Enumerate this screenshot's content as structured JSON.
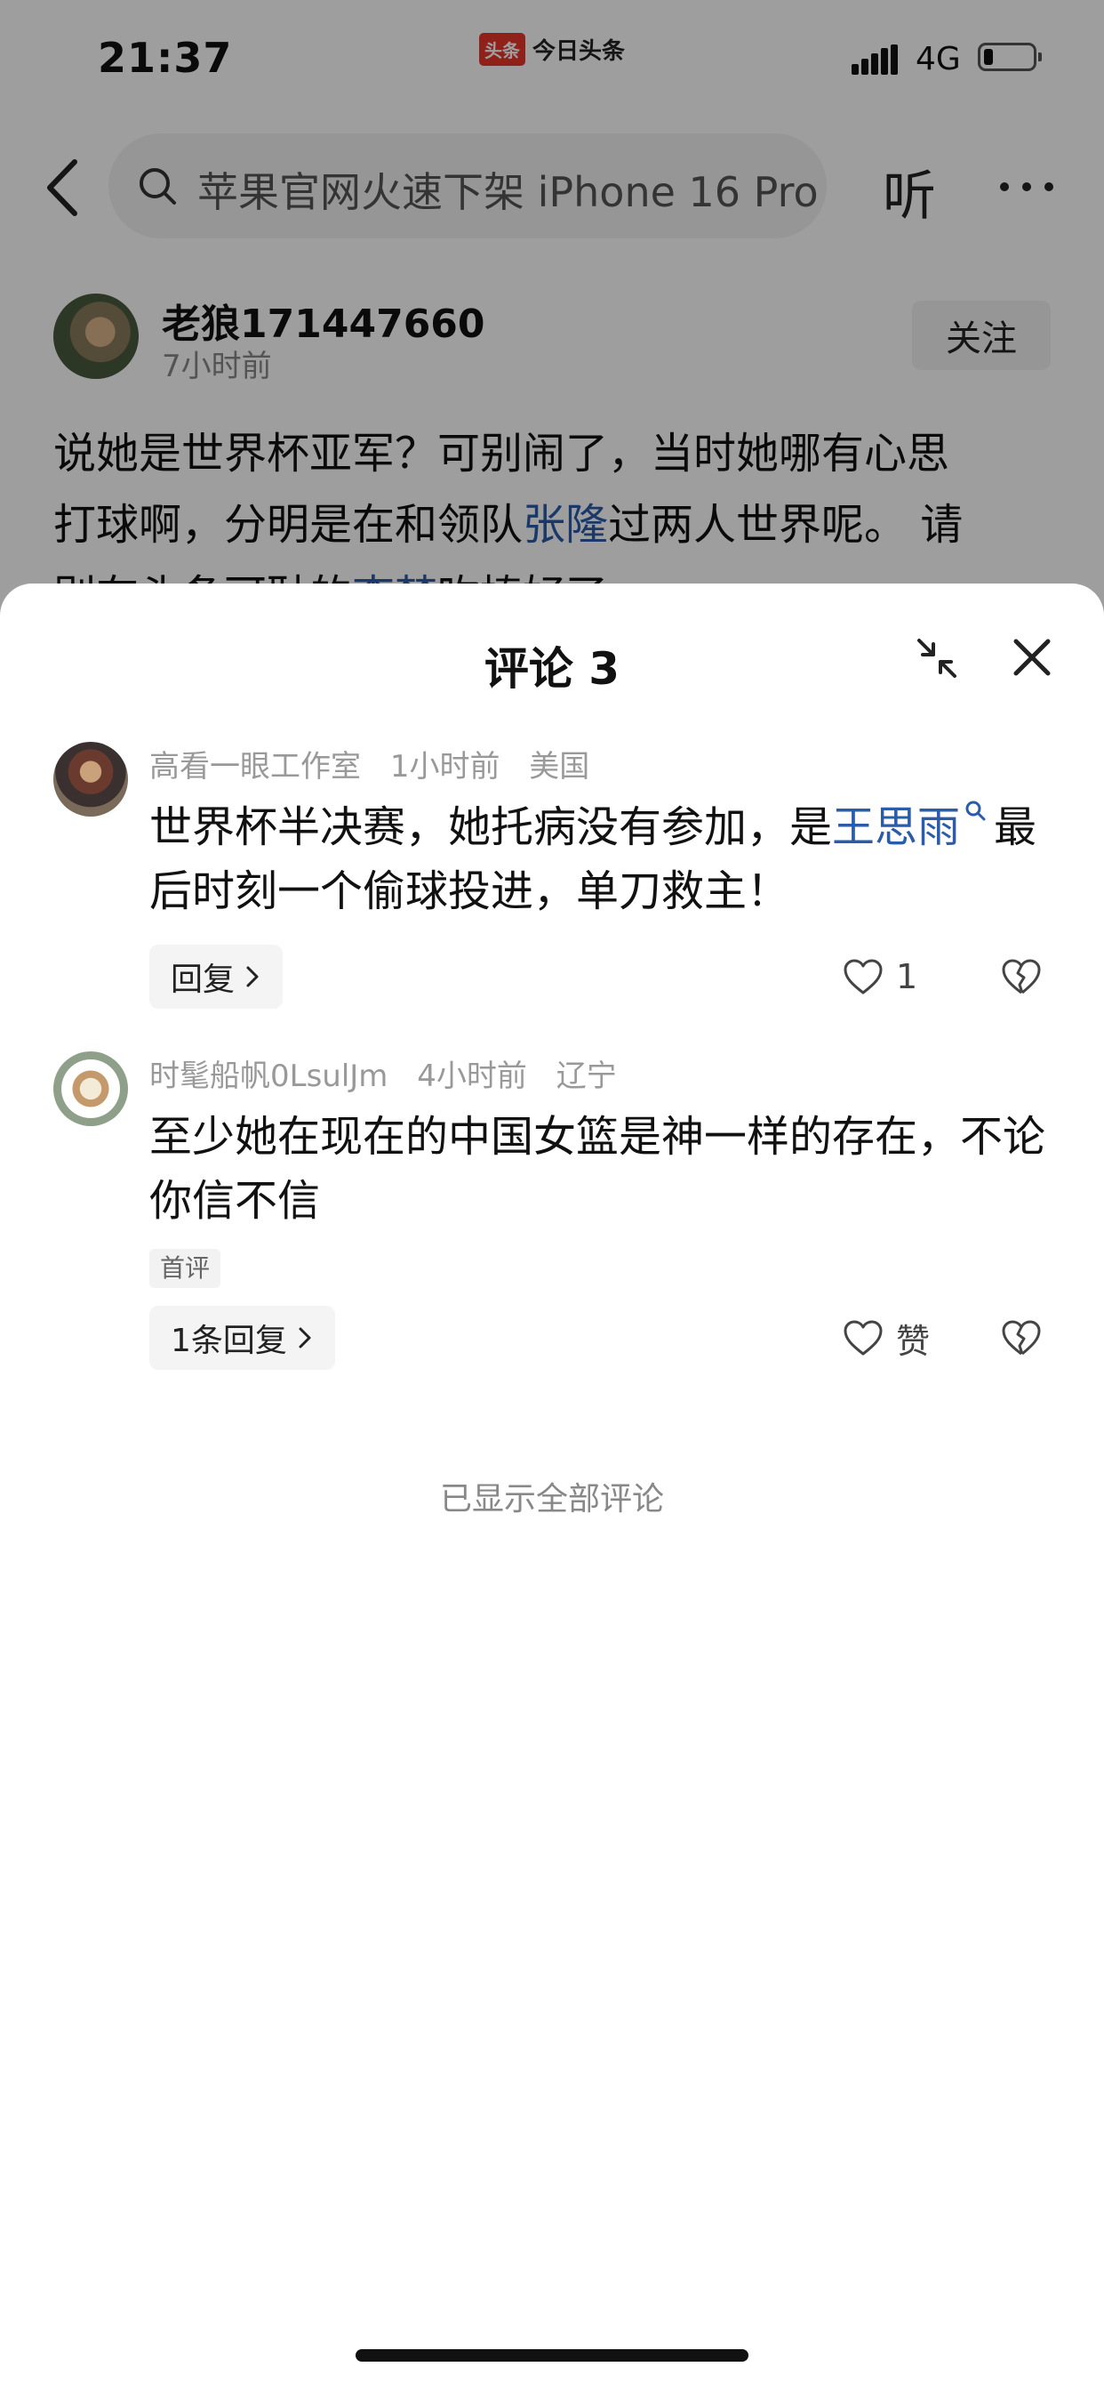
{
  "status_bar": {
    "time": "21:37",
    "app_badge_logo": "头条",
    "app_badge_name": "今日头条",
    "network": "4G",
    "battery_level": 0.2,
    "icons": [
      "signal-icon",
      "battery-icon"
    ]
  },
  "nav": {
    "search_text": "苹果官网火速下架 iPhone 16 Pro",
    "listen_label": "听",
    "icons": [
      "back-arrow-icon",
      "search-icon",
      "more-dots-icon"
    ]
  },
  "author": {
    "name": "老狼171447660",
    "time": "7小时前",
    "follow_label": "关注"
  },
  "article": {
    "line1": "说她是世界杯亚军？可别闹了，当时她哪有心思",
    "line2_pre": "打球啊，分明是在和领队",
    "line2_link": "张隆",
    "line2_post": "过两人世界呢。 请",
    "line3_pre": "别在头条可耻的",
    "line3_link": "李梦",
    "line3_post": "吹捧好了"
  },
  "sheet": {
    "title": "评论 3",
    "icons": [
      "collapse-icon",
      "close-icon"
    ],
    "all_shown": "已显示全部评论"
  },
  "comments": [
    {
      "user": "高看一眼工作室",
      "time": "1小时前",
      "location": "美国",
      "text_pre": "世界杯半决赛，她托病没有参加，是",
      "text_link": "王思雨",
      "text_post": "最后时刻一个偷球投进，单刀救主！",
      "reply_label": "回复",
      "like_label": "1"
    },
    {
      "user": "时髦船帆0LsulJm",
      "time": "4小时前",
      "location": "辽宁",
      "text": "至少她在现在的中国女篮是神一样的存在，不论你信不信",
      "tag": "首评",
      "reply_label": "1条回复",
      "like_label": "赞"
    }
  ],
  "colors": {
    "link": "#2a5caa",
    "overlay": "rgba(0,0,0,0.38)",
    "app_logo": "#e8362b"
  }
}
